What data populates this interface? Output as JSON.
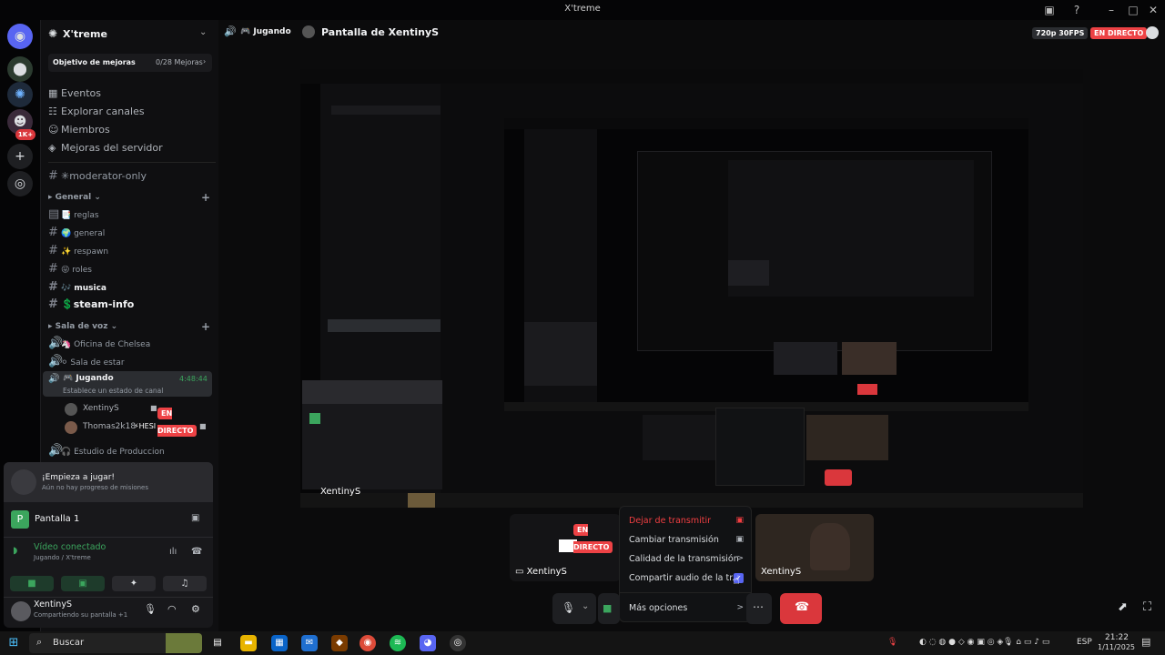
{
  "window": {
    "title": "X'treme"
  },
  "server": {
    "name": "X'treme"
  },
  "quest": {
    "label": "Objetivo de mejoras",
    "progress": "0/28 Mejoras"
  },
  "nav": [
    {
      "label": "Eventos",
      "icon": "calendar-icon"
    },
    {
      "label": "Explorar canales",
      "icon": "compass-icon"
    },
    {
      "label": "Miembros",
      "icon": "members-icon"
    },
    {
      "label": "Mejoras del servidor",
      "icon": "boost-icon"
    }
  ],
  "channels_top": {
    "moderator": "✳moderator-only"
  },
  "categories": {
    "general": "General",
    "voice": "Sala de voz"
  },
  "text_channels": [
    {
      "label": "📑 reglas"
    },
    {
      "label": "🌍 general"
    },
    {
      "label": "✨ respawn"
    },
    {
      "label": "😜 roles"
    },
    {
      "label": "🎶 musica"
    },
    {
      "label": "💲steam-info"
    }
  ],
  "voice_channels": {
    "chelsea": "🦄 Oficina de Chelsea",
    "estar": "⚪ Sala de estar",
    "jugando": "🎮 Jugando",
    "jugando_time": "4:48:44",
    "jugando_status": "Establece un estado de canal",
    "produccion": "🎧 Estudio de Produccion"
  },
  "voice_users": [
    {
      "name": "XentinyS",
      "badge": "EN DIRECTO"
    },
    {
      "name": "Thomas2k18",
      "tag": "⚡HESI"
    }
  ],
  "activity": {
    "title": "¡Empieza a jugar!",
    "subtitle": "Aún no hay progreso de misiones",
    "screen": "Pantalla 1",
    "connected": "Vídeo conectado",
    "connected_sub": "Jugando / X'treme"
  },
  "user": {
    "name": "XentinyS",
    "status": "Compartiendo su pantalla +1"
  },
  "rail": {
    "badge": "1K+"
  },
  "topbar": {
    "channel": "🎮 Jugando",
    "stream_title": "Pantalla de XentinyS",
    "quality": "720p 30FPS",
    "live": "EN DIRECTO"
  },
  "tiles": [
    {
      "name": "XentinyS",
      "badge": "EN DIRECTO"
    },
    {
      "name": "XentinyS"
    }
  ],
  "stream_user": "XentinyS",
  "menu": [
    {
      "label": "Dejar de transmitir"
    },
    {
      "label": "Cambiar transmisión"
    },
    {
      "label": "Calidad de la transmisión",
      "arrow": ">"
    },
    {
      "label": "Compartir audio de la tr..."
    },
    {
      "label": "Más opciones",
      "arrow": ">"
    }
  ],
  "taskbar": {
    "search": "Buscar",
    "lang": "ESP",
    "time": "21:22",
    "date": "1/11/2025"
  },
  "colors": {
    "live": "#ed4245",
    "green": "#3ba55d",
    "blurple": "#5865f2"
  }
}
